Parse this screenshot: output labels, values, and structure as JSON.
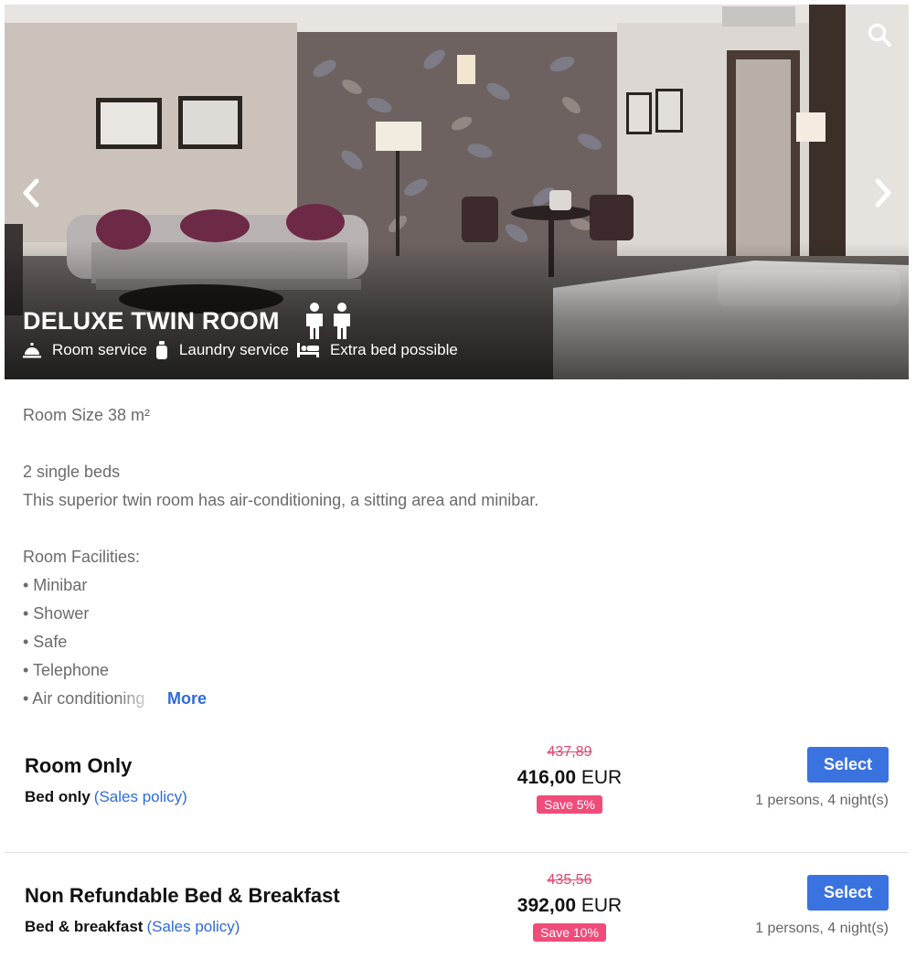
{
  "room": {
    "title": "DELUXE TWIN ROOM",
    "occupancy_icon": "person-icon",
    "features": [
      {
        "icon": "room-service-bell-icon",
        "label": "Room service"
      },
      {
        "icon": "laundry-bottle-icon",
        "label": "Laundry service"
      },
      {
        "icon": "bed-icon",
        "label": "Extra bed possible"
      }
    ]
  },
  "gallery": {
    "prev_icon": "chevron-left-icon",
    "next_icon": "chevron-right-icon",
    "search_icon": "search-icon"
  },
  "description": {
    "size": "Room Size 38 m²",
    "beds": "2 single beds",
    "summary": "This superior twin room has air-conditioning, a sitting area and minibar.",
    "facilities_heading": "Room Facilities:",
    "facilities": [
      "• Minibar",
      "• Shower",
      "• Safe",
      "• Telephone",
      "• Air conditioning"
    ],
    "more_label": "More"
  },
  "rates": [
    {
      "name": "Room Only",
      "board": "Bed only",
      "policy_label": "(Sales policy)",
      "old_price": "437,89",
      "price": "416,00",
      "currency": "EUR",
      "save": "Save 5%",
      "select_label": "Select",
      "stay": "1 persons, 4 night(s)"
    },
    {
      "name": "Non Refundable Bed & Breakfast",
      "board": "Bed & breakfast",
      "policy_label": "(Sales policy)",
      "old_price": "435,56",
      "price": "392,00",
      "currency": "EUR",
      "save": "Save 10%",
      "select_label": "Select",
      "stay": "1 persons, 4 night(s)"
    }
  ],
  "colors": {
    "accent": "#3a72e0",
    "link": "#2f6bd8",
    "old_price": "#e04870",
    "save_badge": "#f04c7a"
  }
}
